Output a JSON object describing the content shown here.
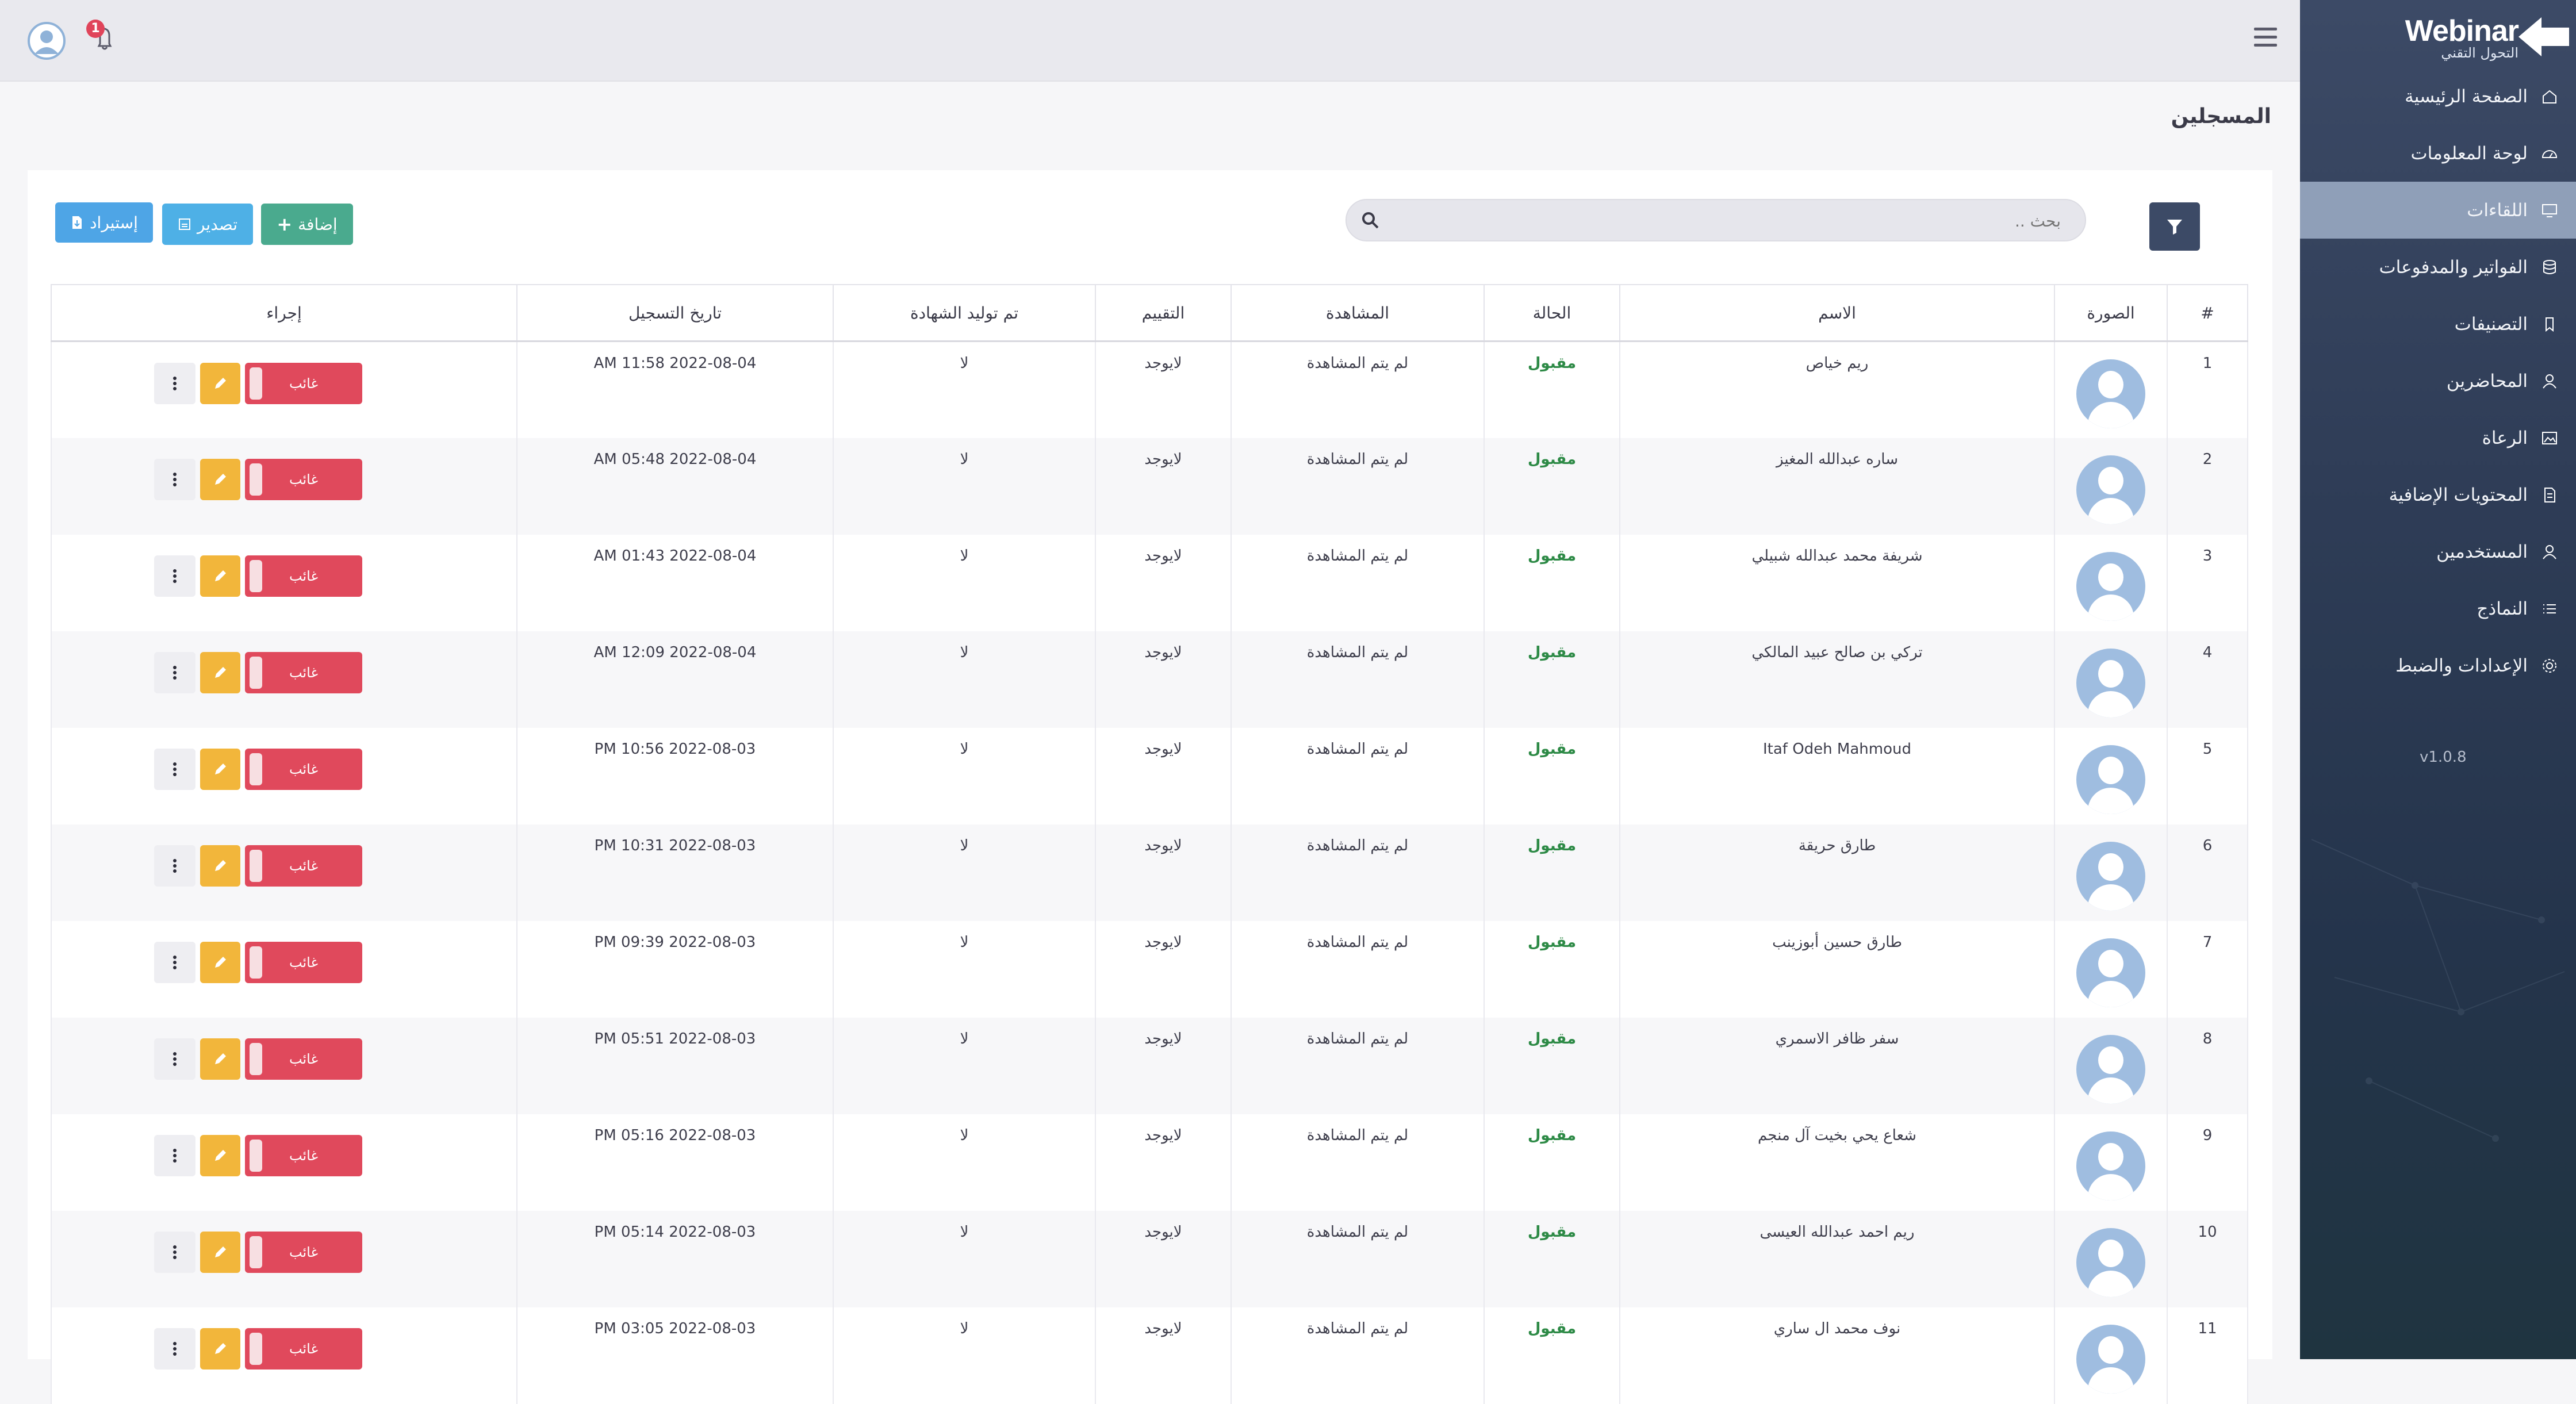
{
  "header": {
    "notification_count": "1"
  },
  "sidebar": {
    "logo_text": "Webinar",
    "logo_subtitle": "التحول التقني",
    "items": [
      {
        "label": "الصفحة الرئيسية",
        "icon": "home-icon",
        "active": false
      },
      {
        "label": "لوحة المعلومات",
        "icon": "dashboard-icon",
        "active": false
      },
      {
        "label": "اللقاءات",
        "icon": "monitor-icon",
        "active": true
      },
      {
        "label": "الفواتير والمدفوعات",
        "icon": "database-icon",
        "active": false
      },
      {
        "label": "التصنيفات",
        "icon": "tag-icon",
        "active": false
      },
      {
        "label": "المحاضرين",
        "icon": "user-icon",
        "active": false
      },
      {
        "label": "الرعاة",
        "icon": "image-icon",
        "active": false
      },
      {
        "label": "المحتويات الإضافية",
        "icon": "file-icon",
        "active": false
      },
      {
        "label": "المستخدمين",
        "icon": "user-icon",
        "active": false
      },
      {
        "label": "النماذج",
        "icon": "list-icon",
        "active": false
      },
      {
        "label": "الإعدادات والضبط",
        "icon": "gear-icon",
        "active": false
      }
    ],
    "version": "v1.0.8"
  },
  "page": {
    "title": "المسجلين"
  },
  "toolbar": {
    "search_placeholder": "بحث ..",
    "add_label": "إضافة",
    "export_label": "تصدير",
    "import_label": "إستيراد"
  },
  "table": {
    "headers": [
      "#",
      "الصورة",
      "الاسم",
      "الحالة",
      "المشاهدة",
      "التقييم",
      "تم توليد الشهادة",
      "تاريخ التسجيل",
      "إجراء"
    ],
    "rows": [
      {
        "num": "1",
        "name": "ريم خياص",
        "status": "مقبول",
        "watch": "لم يتم المشاهدة",
        "rating": "لايوجد",
        "cert": "لا",
        "date": "2022-08-04 11:58 AM",
        "action": "غائب"
      },
      {
        "num": "2",
        "name": "ساره عبدالله المغيز",
        "status": "مقبول",
        "watch": "لم يتم المشاهدة",
        "rating": "لايوجد",
        "cert": "لا",
        "date": "2022-08-04 05:48 AM",
        "action": "غائب"
      },
      {
        "num": "3",
        "name": "شريفة محمد عبدالله شبيلي",
        "status": "مقبول",
        "watch": "لم يتم المشاهدة",
        "rating": "لايوجد",
        "cert": "لا",
        "date": "2022-08-04 01:43 AM",
        "action": "غائب"
      },
      {
        "num": "4",
        "name": "تركي بن صالح عبيد المالكي",
        "status": "مقبول",
        "watch": "لم يتم المشاهدة",
        "rating": "لايوجد",
        "cert": "لا",
        "date": "2022-08-04 12:09 AM",
        "action": "غائب"
      },
      {
        "num": "5",
        "name": "Itaf Odeh Mahmoud",
        "status": "مقبول",
        "watch": "لم يتم المشاهدة",
        "rating": "لايوجد",
        "cert": "لا",
        "date": "2022-08-03 10:56 PM",
        "action": "غائب"
      },
      {
        "num": "6",
        "name": "طارق حريقة",
        "status": "مقبول",
        "watch": "لم يتم المشاهدة",
        "rating": "لايوجد",
        "cert": "لا",
        "date": "2022-08-03 10:31 PM",
        "action": "غائب"
      },
      {
        "num": "7",
        "name": "طارق حسين أبوزينب",
        "status": "مقبول",
        "watch": "لم يتم المشاهدة",
        "rating": "لايوجد",
        "cert": "لا",
        "date": "2022-08-03 09:39 PM",
        "action": "غائب"
      },
      {
        "num": "8",
        "name": "سفر ظافر الاسمري",
        "status": "مقبول",
        "watch": "لم يتم المشاهدة",
        "rating": "لايوجد",
        "cert": "لا",
        "date": "2022-08-03 05:51 PM",
        "action": "غائب"
      },
      {
        "num": "9",
        "name": "شعاع يحي بخيت آل منجم",
        "status": "مقبول",
        "watch": "لم يتم المشاهدة",
        "rating": "لايوجد",
        "cert": "لا",
        "date": "2022-08-03 05:16 PM",
        "action": "غائب"
      },
      {
        "num": "10",
        "name": "ريم احمد عبدالله العيسى",
        "status": "مقبول",
        "watch": "لم يتم المشاهدة",
        "rating": "لايوجد",
        "cert": "لا",
        "date": "2022-08-03 05:14 PM",
        "action": "غائب"
      },
      {
        "num": "11",
        "name": "نوف محمد ال ساري",
        "status": "مقبول",
        "watch": "لم يتم المشاهدة",
        "rating": "لايوجد",
        "cert": "لا",
        "date": "2022-08-03 03:05 PM",
        "action": "غائب"
      }
    ]
  },
  "colors": {
    "sidebar_bg": "#2f3d57",
    "active_item": "#8f9fb8",
    "add_button": "#4aaa8e",
    "export_button": "#4eb0e6",
    "absent_button": "#e0495c",
    "edit_button": "#f2b63b",
    "accepted_text": "#2d8a46"
  }
}
